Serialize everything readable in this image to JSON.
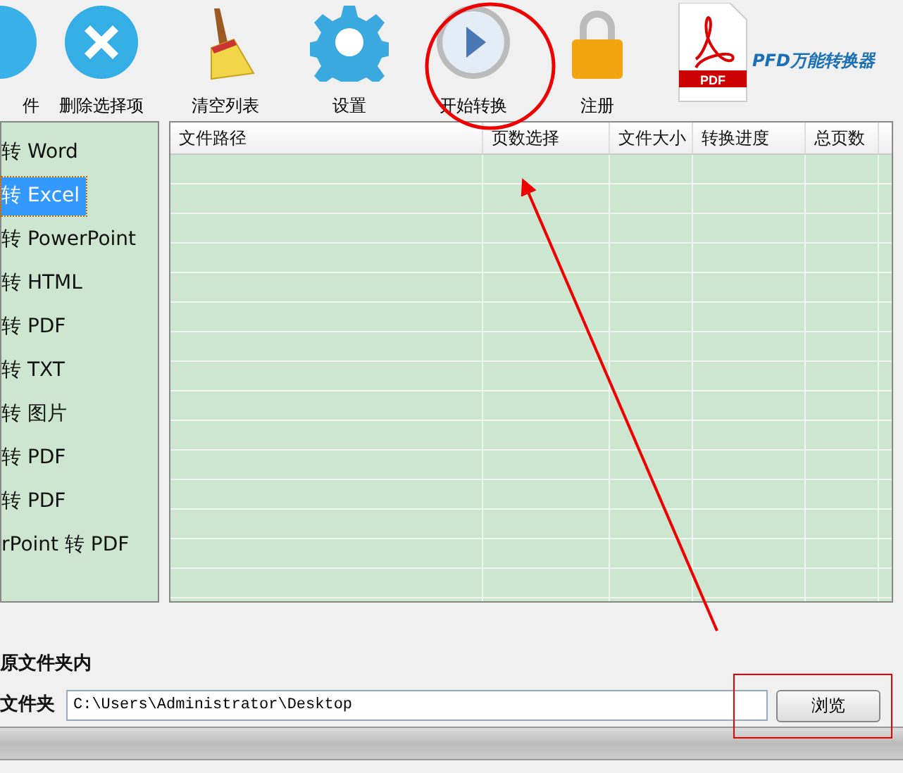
{
  "toolbar": [
    {
      "label": "件"
    },
    {
      "label": "删除选择项"
    },
    {
      "label": "清空列表"
    },
    {
      "label": "设置"
    },
    {
      "label": "开始转换"
    },
    {
      "label": "注册"
    }
  ],
  "logo": {
    "badge": "PDF",
    "title": "PFD万能转换器"
  },
  "conversion_types": [
    {
      "label": "转 Word",
      "selected": false
    },
    {
      "label": "转 Excel",
      "selected": true
    },
    {
      "label": "转 PowerPoint",
      "selected": false
    },
    {
      "label": "转 HTML",
      "selected": false
    },
    {
      "label": "转 PDF",
      "selected": false
    },
    {
      "label": "转 TXT",
      "selected": false
    },
    {
      "label": "转 图片",
      "selected": false
    },
    {
      "label": "转 PDF",
      "selected": false
    },
    {
      "label": "转 PDF",
      "selected": false
    },
    {
      "label": "rPoint 转 PDF",
      "selected": false
    }
  ],
  "table": {
    "columns": [
      "文件路径",
      "页数选择",
      "文件大小",
      "转换进度",
      "总页数"
    ]
  },
  "save_option": {
    "label": "原文件夹内"
  },
  "output_folder": {
    "label": "文件夹",
    "value": "C:\\Users\\Administrator\\Desktop",
    "button": "浏览"
  }
}
